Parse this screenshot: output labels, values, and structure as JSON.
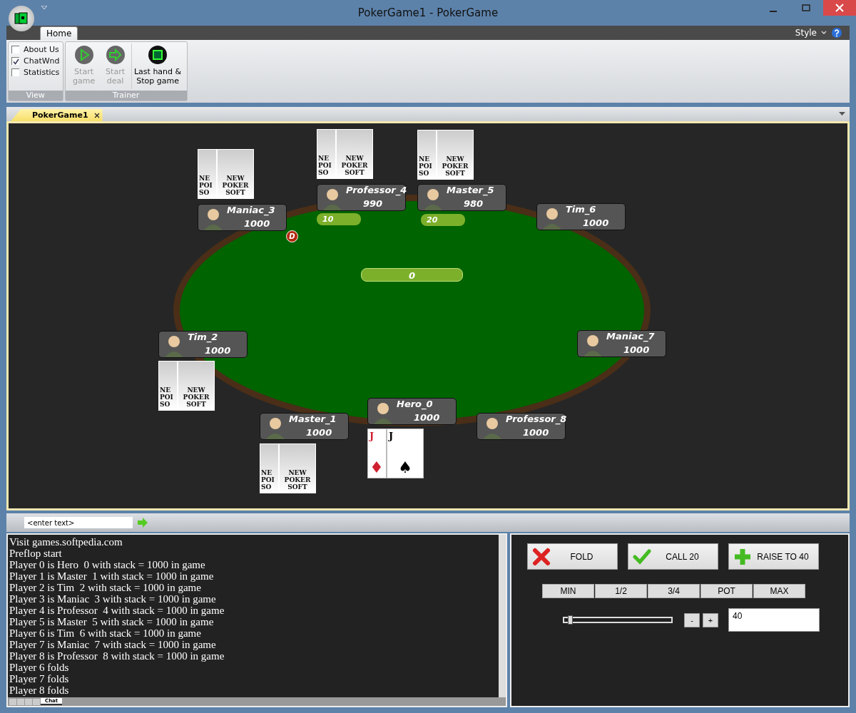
{
  "window": {
    "title": "PokerGame1 - PokerGame"
  },
  "ribbon": {
    "tabs": [
      {
        "label": "Home",
        "selected": true
      }
    ],
    "style_menu": "Style",
    "groups": [
      {
        "label": "View",
        "kind": "checks",
        "items": [
          {
            "label": "About Us",
            "checked": false
          },
          {
            "label": "ChatWnd",
            "checked": true
          },
          {
            "label": "Statistics",
            "checked": false
          }
        ]
      },
      {
        "label": "Trainer",
        "kind": "buttons",
        "items": [
          {
            "label": "Start game",
            "disabled": true
          },
          {
            "label": "Start deal",
            "disabled": true
          },
          {
            "label": "Last hand & Stop game",
            "disabled": false
          }
        ]
      }
    ]
  },
  "document_tabs": [
    {
      "label": "PokerGame1",
      "selected": true
    }
  ],
  "table": {
    "pot": "0",
    "dealer": "D",
    "players": [
      {
        "name": "Hero_0",
        "stack": "1000",
        "cards": [
          {
            "kind": "face",
            "rank": "J",
            "suit": "♦"
          },
          {
            "kind": "face",
            "rank": "J",
            "suit": "♠"
          }
        ]
      },
      {
        "name": "Master_1",
        "stack": "1000",
        "cards": [
          {
            "kind": "back",
            "lines": [
              "NE",
              "POI",
              "SO"
            ]
          },
          {
            "kind": "back",
            "lines": [
              "NEW",
              "POKER",
              "SOFT"
            ]
          }
        ]
      },
      {
        "name": "Tim_2",
        "stack": "1000",
        "cards": [
          {
            "kind": "back",
            "lines": [
              "NE",
              "POI",
              "SO"
            ]
          },
          {
            "kind": "back",
            "lines": [
              "NEW",
              "POKER",
              "SOFT"
            ]
          }
        ]
      },
      {
        "name": "Maniac_3",
        "stack": "1000",
        "cards": [
          {
            "kind": "back",
            "lines": [
              "NE",
              "POI",
              "SO"
            ]
          },
          {
            "kind": "back",
            "lines": [
              "NEW",
              "POKER",
              "SOFT"
            ]
          }
        ]
      },
      {
        "name": "Professor_4",
        "stack": "990",
        "bet": "10",
        "cards": [
          {
            "kind": "back",
            "lines": [
              "NE",
              "POI",
              "SO"
            ]
          },
          {
            "kind": "back",
            "lines": [
              "NEW",
              "POKER",
              "SOFT"
            ]
          }
        ]
      },
      {
        "name": "Master_5",
        "stack": "980",
        "bet": "20",
        "cards": [
          {
            "kind": "back",
            "lines": [
              "NE",
              "POI",
              "SO"
            ]
          },
          {
            "kind": "back",
            "lines": [
              "NEW",
              "POKER",
              "SOFT"
            ]
          }
        ]
      },
      {
        "name": "Tim_6",
        "stack": "1000"
      },
      {
        "name": "Maniac_7",
        "stack": "1000"
      },
      {
        "name": "Professor_8",
        "stack": "1000"
      }
    ]
  },
  "chat_input": {
    "placeholder": "<enter text>"
  },
  "log": {
    "lines": [
      "Visit games.softpedia.com",
      "Preflop start",
      "Player 0 is Hero  0 with stack = 1000 in game",
      "Player 1 is Master  1 with stack = 1000 in game",
      "Player 2 is Tim  2 with stack = 1000 in game",
      "Player 3 is Maniac  3 with stack = 1000 in game",
      "Player 4 is Professor  4 with stack = 1000 in game",
      "Player 5 is Master  5 with stack = 1000 in game",
      "Player 6 is Tim  6 with stack = 1000 in game",
      "Player 7 is Maniac  7 with stack = 1000 in game",
      "Player 8 is Professor  8 with stack = 1000 in game",
      "Player 6 folds",
      "Player 7 folds",
      "Player 8 folds"
    ],
    "tabs": [
      {
        "label": "Chat",
        "selected": true
      }
    ]
  },
  "actions": [
    {
      "label": "FOLD",
      "kind": "fold"
    },
    {
      "label": "CALL 20",
      "kind": "call"
    },
    {
      "label": "RAISE TO 40",
      "kind": "raise"
    }
  ],
  "bet_presets": [
    "MIN",
    "1/2",
    "3/4",
    "POT",
    "MAX"
  ],
  "bet_slider": {
    "level": 0.03
  },
  "step_buttons": [
    "-",
    "+"
  ],
  "bet_amount": "40"
}
